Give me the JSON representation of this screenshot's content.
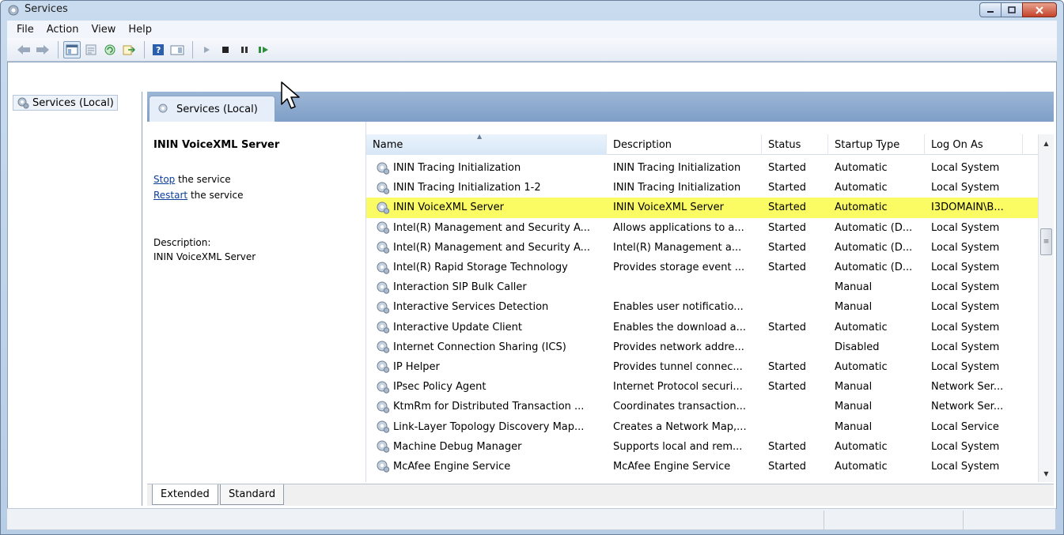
{
  "window": {
    "title": "Services"
  },
  "menu": [
    "File",
    "Action",
    "View",
    "Help"
  ],
  "tree": {
    "root_label": "Services (Local)"
  },
  "panel": {
    "header_label": "Services (Local)"
  },
  "details": {
    "service_title": "ININ VoiceXML Server",
    "stop_link": "Stop",
    "stop_rest": " the service",
    "restart_link": "Restart",
    "restart_rest": " the service",
    "description_label": "Description:",
    "description_text": "ININ VoiceXML Server"
  },
  "table": {
    "columns": [
      "Name",
      "Description",
      "Status",
      "Startup Type",
      "Log On As"
    ],
    "rows": [
      [
        "ININ Tracing Initialization",
        "ININ Tracing Initialization",
        "Started",
        "Automatic",
        "Local System"
      ],
      [
        "ININ Tracing Initialization 1-2",
        "ININ Tracing Initialization",
        "Started",
        "Automatic",
        "Local System"
      ],
      [
        "ININ VoiceXML Server",
        "ININ VoiceXML Server",
        "Started",
        "Automatic",
        "I3DOMAIN\\B..."
      ],
      [
        "Intel(R) Management and Security A...",
        "Allows applications to a...",
        "Started",
        "Automatic (D...",
        "Local System"
      ],
      [
        "Intel(R) Management and Security A...",
        "Intel(R) Management a...",
        "Started",
        "Automatic (D...",
        "Local System"
      ],
      [
        "Intel(R) Rapid Storage Technology",
        "Provides storage event ...",
        "Started",
        "Automatic (D...",
        "Local System"
      ],
      [
        "Interaction SIP Bulk Caller",
        "",
        "",
        "Manual",
        "Local System"
      ],
      [
        "Interactive Services Detection",
        "Enables user notificatio...",
        "",
        "Manual",
        "Local System"
      ],
      [
        "Interactive Update Client",
        "Enables the download a...",
        "Started",
        "Automatic",
        "Local System"
      ],
      [
        "Internet Connection Sharing (ICS)",
        "Provides network addre...",
        "",
        "Disabled",
        "Local System"
      ],
      [
        "IP Helper",
        "Provides tunnel connec...",
        "Started",
        "Automatic",
        "Local System"
      ],
      [
        "IPsec Policy Agent",
        "Internet Protocol securi...",
        "Started",
        "Manual",
        "Network Ser..."
      ],
      [
        "KtmRm for Distributed Transaction ...",
        "Coordinates transaction...",
        "",
        "Manual",
        "Network Ser..."
      ],
      [
        "Link-Layer Topology Discovery Map...",
        "Creates a Network Map,...",
        "",
        "Manual",
        "Local Service"
      ],
      [
        "Machine Debug Manager",
        "Supports local and rem...",
        "Started",
        "Automatic",
        "Local System"
      ],
      [
        "McAfee Engine Service",
        "McAfee Engine Service",
        "Started",
        "Automatic",
        "Local System"
      ]
    ],
    "selected_index": 2
  },
  "tabs": {
    "extended": "Extended",
    "standard": "Standard"
  },
  "colors": {
    "highlight": "#fbfc64",
    "accent": "#7f9fc8"
  }
}
